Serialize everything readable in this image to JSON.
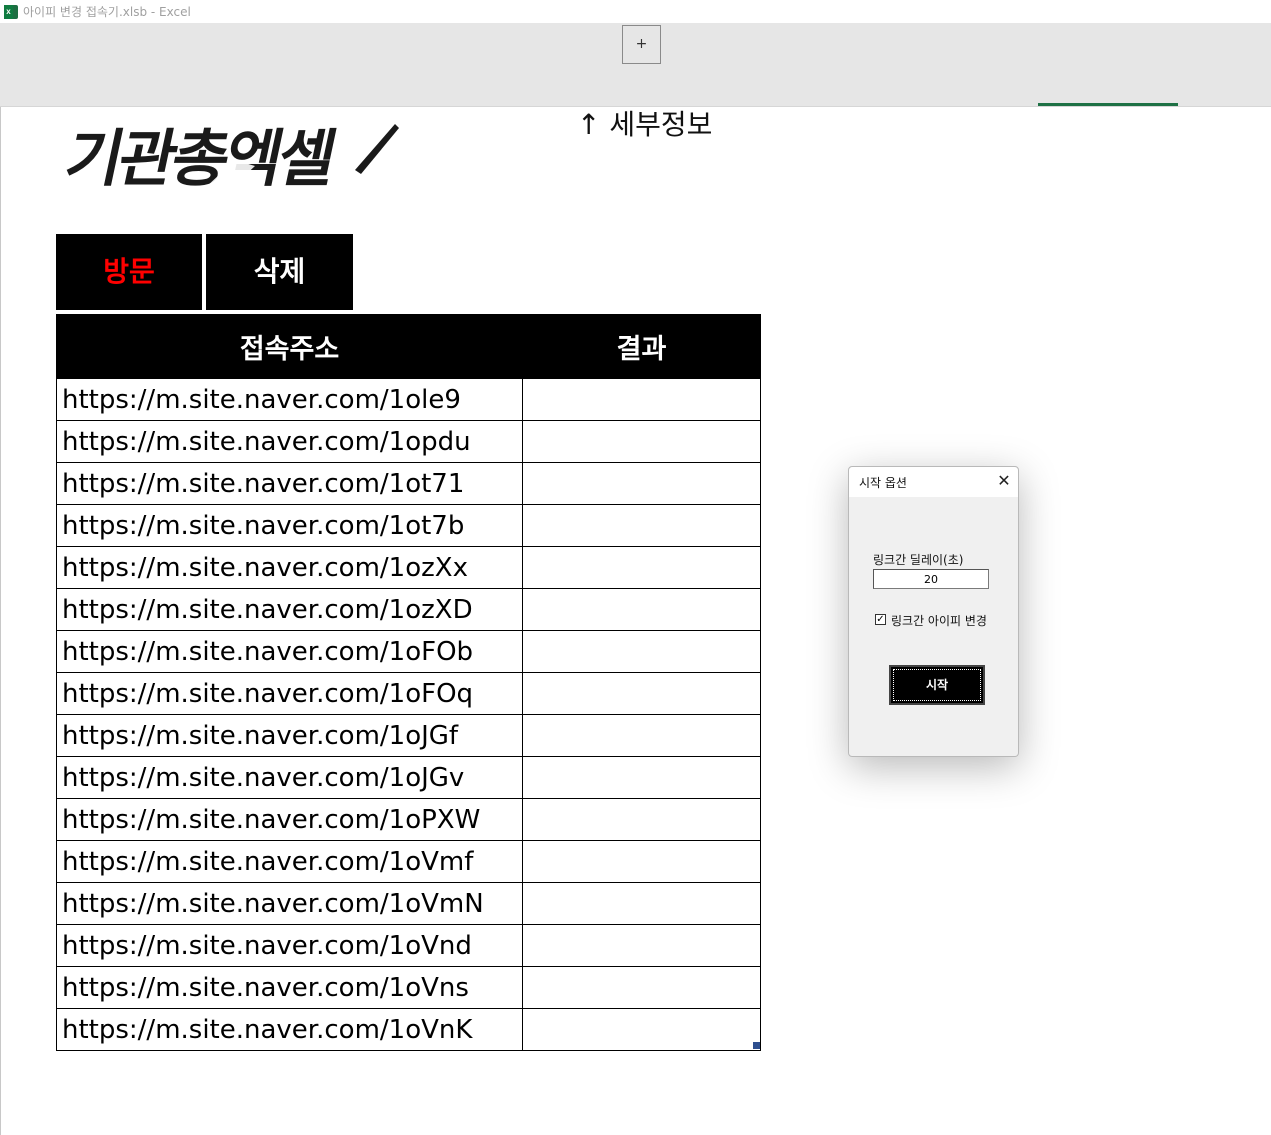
{
  "window": {
    "title": "아이피 변경 접속기.xlsb - Excel",
    "app_icon": "excel-icon"
  },
  "ribbon": {
    "expand_label": "+"
  },
  "sheet": {
    "logo_text": "기관총엑셀",
    "detail_label": "↑ 세부정보",
    "visit_button": "방문",
    "delete_button": "삭제",
    "visit_color": "#ff0000",
    "table": {
      "headers": [
        "접속주소",
        "결과"
      ],
      "rows": [
        {
          "url": "https://m.site.naver.com/1ole9",
          "result": ""
        },
        {
          "url": "https://m.site.naver.com/1opdu",
          "result": ""
        },
        {
          "url": "https://m.site.naver.com/1ot71",
          "result": ""
        },
        {
          "url": "https://m.site.naver.com/1ot7b",
          "result": ""
        },
        {
          "url": "https://m.site.naver.com/1ozXx",
          "result": ""
        },
        {
          "url": "https://m.site.naver.com/1ozXD",
          "result": ""
        },
        {
          "url": "https://m.site.naver.com/1oFOb",
          "result": ""
        },
        {
          "url": "https://m.site.naver.com/1oFOq",
          "result": ""
        },
        {
          "url": "https://m.site.naver.com/1oJGf",
          "result": ""
        },
        {
          "url": "https://m.site.naver.com/1oJGv",
          "result": ""
        },
        {
          "url": "https://m.site.naver.com/1oPXW",
          "result": ""
        },
        {
          "url": "https://m.site.naver.com/1oVmf",
          "result": ""
        },
        {
          "url": "https://m.site.naver.com/1oVmN",
          "result": ""
        },
        {
          "url": "https://m.site.naver.com/1oVnd",
          "result": ""
        },
        {
          "url": "https://m.site.naver.com/1oVns",
          "result": ""
        },
        {
          "url": "https://m.site.naver.com/1oVnK",
          "result": ""
        }
      ]
    }
  },
  "dialog": {
    "title": "시작 옵션",
    "close_icon": "close-icon",
    "delay_label": "링크간 딜레이(초)",
    "delay_value": "20",
    "ip_change_label": "링크간 아이피 변경",
    "ip_change_checked": true,
    "start_button": "시작"
  }
}
